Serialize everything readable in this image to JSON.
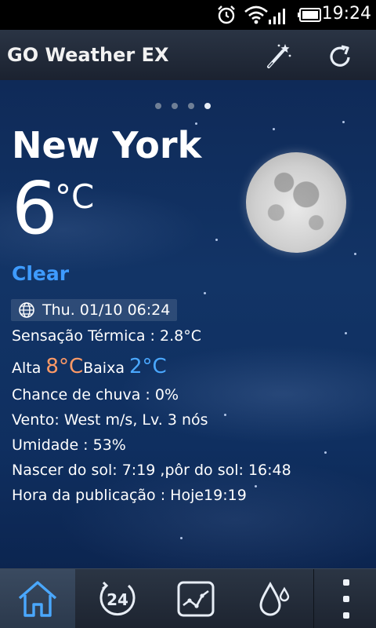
{
  "status_bar": {
    "time": "19:24",
    "icons": [
      "alarm-icon",
      "wifi-icon",
      "signal-icon",
      "battery-icon"
    ]
  },
  "header": {
    "title": "GO Weather EX",
    "actions": [
      "magic-wand-icon",
      "refresh-icon"
    ]
  },
  "pager": {
    "count": 4,
    "active_index": 3
  },
  "weather": {
    "city": "New York",
    "temperature": "6",
    "unit": "°C",
    "condition": "Clear",
    "datetime": "Thu. 01/10 06:24",
    "feels_like": "Sensação Térmica : 2.8°C",
    "high_label": "Alta",
    "high_value": "8°C",
    "low_label": "Baixa",
    "low_value": "2°C",
    "rain_chance": "Chance de chuva : 0%",
    "wind": "Vento: West m/s, Lv. 3 nós",
    "humidity": "Umidade : 53%",
    "sun": "Nascer do sol: 7:19 ,pôr do sol: 16:48",
    "published": "Hora da publicação : Hoje19:19"
  },
  "bottom_nav": {
    "items": [
      "home-icon",
      "24-hour-icon",
      "trend-chart-icon",
      "precipitation-icon",
      "overflow-menu-icon"
    ],
    "active": "home-icon"
  },
  "colors": {
    "accent_blue": "#3e9bff",
    "high_temp": "#ff9a66",
    "low_temp": "#4aa8ff",
    "sky": "#123466"
  }
}
